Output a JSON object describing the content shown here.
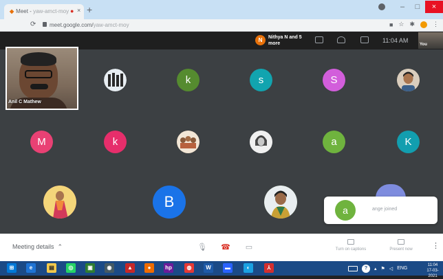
{
  "browser": {
    "tab_title": "Meet - ",
    "tab_title_dim": "yaw-amct-moy",
    "new_tab": "+",
    "url": "meet.google.com/",
    "url_dim": "yaw-amct-moy"
  },
  "meet": {
    "presenter_initial": "N",
    "presenter_text": "Nithya N and 5 more",
    "clock": "11:04 AM",
    "self_label": "You"
  },
  "participants": {
    "speaker_name": "Anil C Mathew",
    "row1": [
      {
        "initial": "",
        "color": "#3c4043"
      },
      {
        "initial": "k",
        "color": "#558b2f"
      },
      {
        "initial": "s",
        "color": "#12a4af"
      },
      {
        "initial": "S",
        "color": "#d25edb"
      },
      {
        "initial": "",
        "color": "#c9b29a"
      }
    ],
    "row2": [
      {
        "initial": "M",
        "color": "#e94174"
      },
      {
        "initial": "k",
        "color": "#e62e6b"
      },
      {
        "initial": "",
        "color": "#d1b08a"
      },
      {
        "initial": "",
        "color": "#e8e8e8"
      },
      {
        "initial": "a",
        "color": "#6fb33e"
      },
      {
        "initial": "K",
        "color": "#129eaf"
      }
    ],
    "row3": [
      {
        "initial": "",
        "color": "#d97a6a"
      },
      {
        "initial": "B",
        "color": "#1a73e8"
      },
      {
        "initial": "",
        "color": "#7f9a6c"
      }
    ]
  },
  "toast": {
    "initial": "a",
    "message": "ange joined"
  },
  "controls": {
    "meeting_details": "Meeting details",
    "captions_label": "Turn on captions",
    "present_label": "Present now"
  },
  "taskbar": {
    "tray_lang": "ENG",
    "time": "11:04",
    "date": "17-03-2021"
  }
}
